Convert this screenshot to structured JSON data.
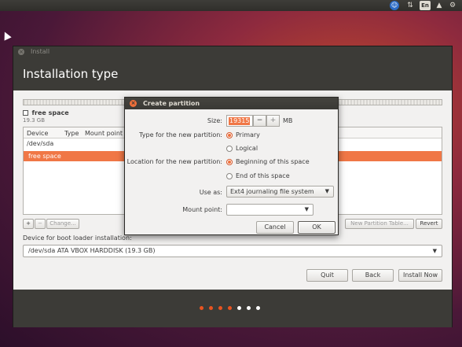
{
  "topbar": {
    "language": "En",
    "icons": [
      "accessibility-icon",
      "network-icon",
      "keyboard-language-icon",
      "volume-icon",
      "gear-icon"
    ]
  },
  "installer": {
    "window_title": "Install",
    "header_title": "Installation type",
    "free_space_legend": {
      "name": "free space",
      "size": "19.3 GB"
    },
    "table": {
      "columns": [
        "Device",
        "Type",
        "Mount point"
      ],
      "rows": [
        {
          "device": "/dev/sda",
          "selected": false
        },
        {
          "device": "free space",
          "selected": true
        }
      ]
    },
    "table_buttons": {
      "add": "+",
      "remove": "−",
      "change": "Change...",
      "new_partition_table": "New Partition Table...",
      "revert": "Revert"
    },
    "bootloader": {
      "label": "Device for boot loader installation:",
      "value": "/dev/sda  ATA VBOX HARDDISK (19.3 GB)"
    },
    "nav_buttons": {
      "quit": "Quit",
      "back": "Back",
      "install_now": "Install Now"
    },
    "progress_dots": {
      "total": 7,
      "active_count": 4,
      "active_color": "#e95420",
      "inactive_color": "#ffffff"
    }
  },
  "dialog": {
    "title": "Create partition",
    "size_label": "Size:",
    "size_value": "19315",
    "size_unit": "MB",
    "minus": "−",
    "plus": "+",
    "type_label": "Type for the new partition:",
    "type_options": [
      "Primary",
      "Logical"
    ],
    "type_selected": "Primary",
    "location_label": "Location for the new partition:",
    "location_options": [
      "Beginning of this space",
      "End of this space"
    ],
    "location_selected": "Beginning of this space",
    "use_as_label": "Use as:",
    "use_as_value": "Ext4 journaling file system",
    "mount_label": "Mount point:",
    "mount_value": "",
    "cancel": "Cancel",
    "ok": "OK"
  },
  "colors": {
    "accent": "#f07746",
    "titlebar": "#3c3b37"
  }
}
